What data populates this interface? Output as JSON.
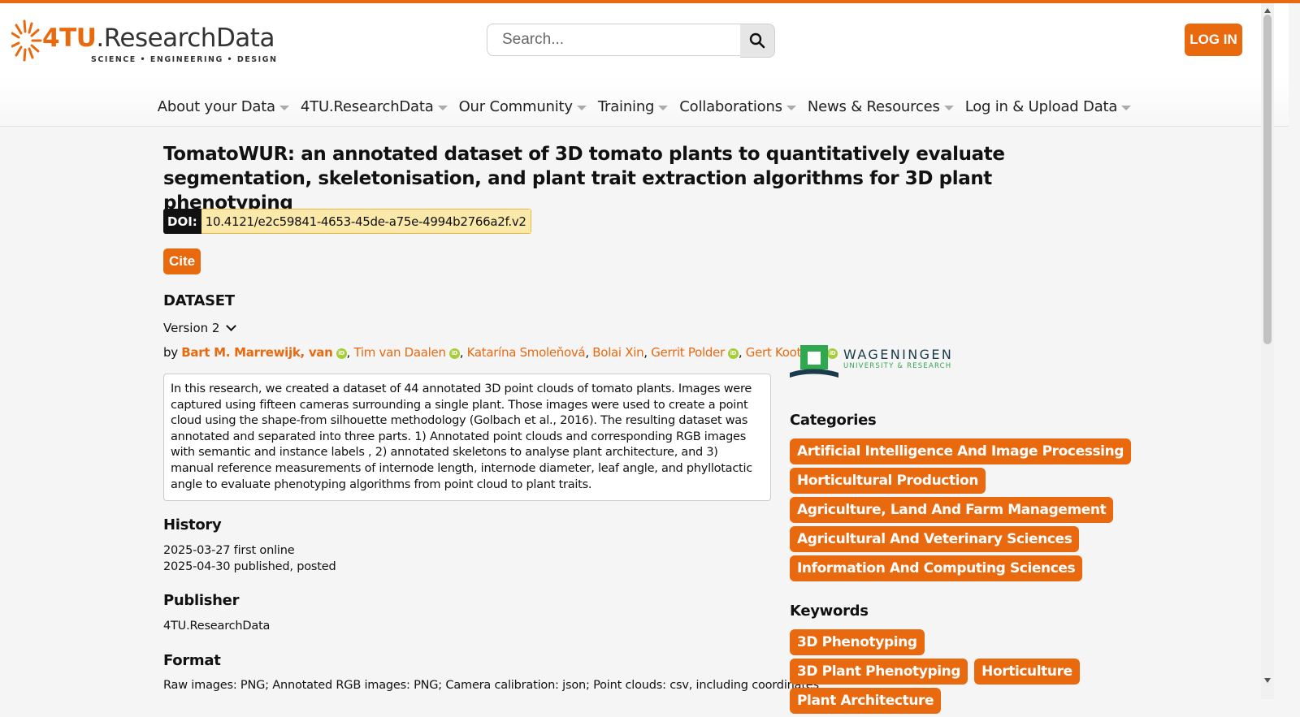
{
  "colors": {
    "accent": "#e9690f",
    "doi_bg": "#fbe9a9",
    "orcid": "#a6ce39"
  },
  "header": {
    "logo": {
      "main_prefix": "4TU",
      "main_suffix": ".ResearchData",
      "subtitle": "SCIENCE • ENGINEERING • DESIGN"
    },
    "search": {
      "placeholder": "Search...",
      "icon": "search-icon"
    },
    "login_label": "LOG IN"
  },
  "nav": [
    {
      "label": "About your Data"
    },
    {
      "label": "4TU.ResearchData"
    },
    {
      "label": "Our Community"
    },
    {
      "label": "Training"
    },
    {
      "label": "Collaborations"
    },
    {
      "label": "News & Resources"
    },
    {
      "label": "Log in & Upload Data"
    }
  ],
  "dataset": {
    "title": "TomatoWUR: an annotated dataset of 3D tomato plants to quantitatively evaluate segmentation, skeletonisation, and plant trait extraction algorithms for 3D plant phenotyping",
    "doi_label": "DOI:",
    "doi_value": "10.4121/e2c59841-4653-45de-a75e-4994b2766a2f.v2",
    "cite_label": "Cite",
    "type_label": "DATASET",
    "version_label": "Version 2",
    "by_label": "by",
    "authors": [
      {
        "name": "Bart M. Marrewijk, van",
        "orcid": true
      },
      {
        "name": "Tim van Daalen",
        "orcid": true
      },
      {
        "name": "Katarína Smoleňová",
        "orcid": false
      },
      {
        "name": "Bolai Xin",
        "orcid": false
      },
      {
        "name": "Gerrit Polder",
        "orcid": true
      },
      {
        "name": "Gert Kootstra",
        "orcid": true
      }
    ],
    "abstract": "In this research, we created a dataset of 44 annotated 3D point clouds of tomato plants. Images were captured using fifteen cameras surrounding a single plant. Those images were used to create a point cloud using the shape-from silhouette methodology (Golbach et al., 2016). The resulting dataset was annotated and separated into three parts. 1) Annotated point clouds and corresponding RGB images with semantic and instance labels , 2) annotated skeletons to analyse plant architecture, and 3) manual reference measurements of internode length, internode diameter, leaf angle, and phyllotactic angle to evaluate phenotyping algorithms from point cloud to plant traits.",
    "history_label": "History",
    "history": [
      "2025-03-27 first online",
      "2025-04-30 published, posted"
    ],
    "publisher_label": "Publisher",
    "publisher": "4TU.ResearchData",
    "format_label": "Format",
    "format": "Raw images: PNG; Annotated RGB images: PNG; Camera calibration: json; Point clouds: csv, including coordinates"
  },
  "sidebar": {
    "institution_logo": {
      "name": "WAGENINGEN",
      "sub": "UNIVERSITY & RESEARCH"
    },
    "categories_label": "Categories",
    "categories": [
      "Artificial Intelligence And Image Processing",
      "Horticultural Production",
      "Agriculture, Land And Farm Management",
      "Agricultural And Veterinary Sciences",
      "Information And Computing Sciences"
    ],
    "keywords_label": "Keywords",
    "keywords": [
      "3D Phenotyping",
      "3D Plant Phenotyping",
      "Horticulture",
      "Plant Architecture"
    ]
  }
}
